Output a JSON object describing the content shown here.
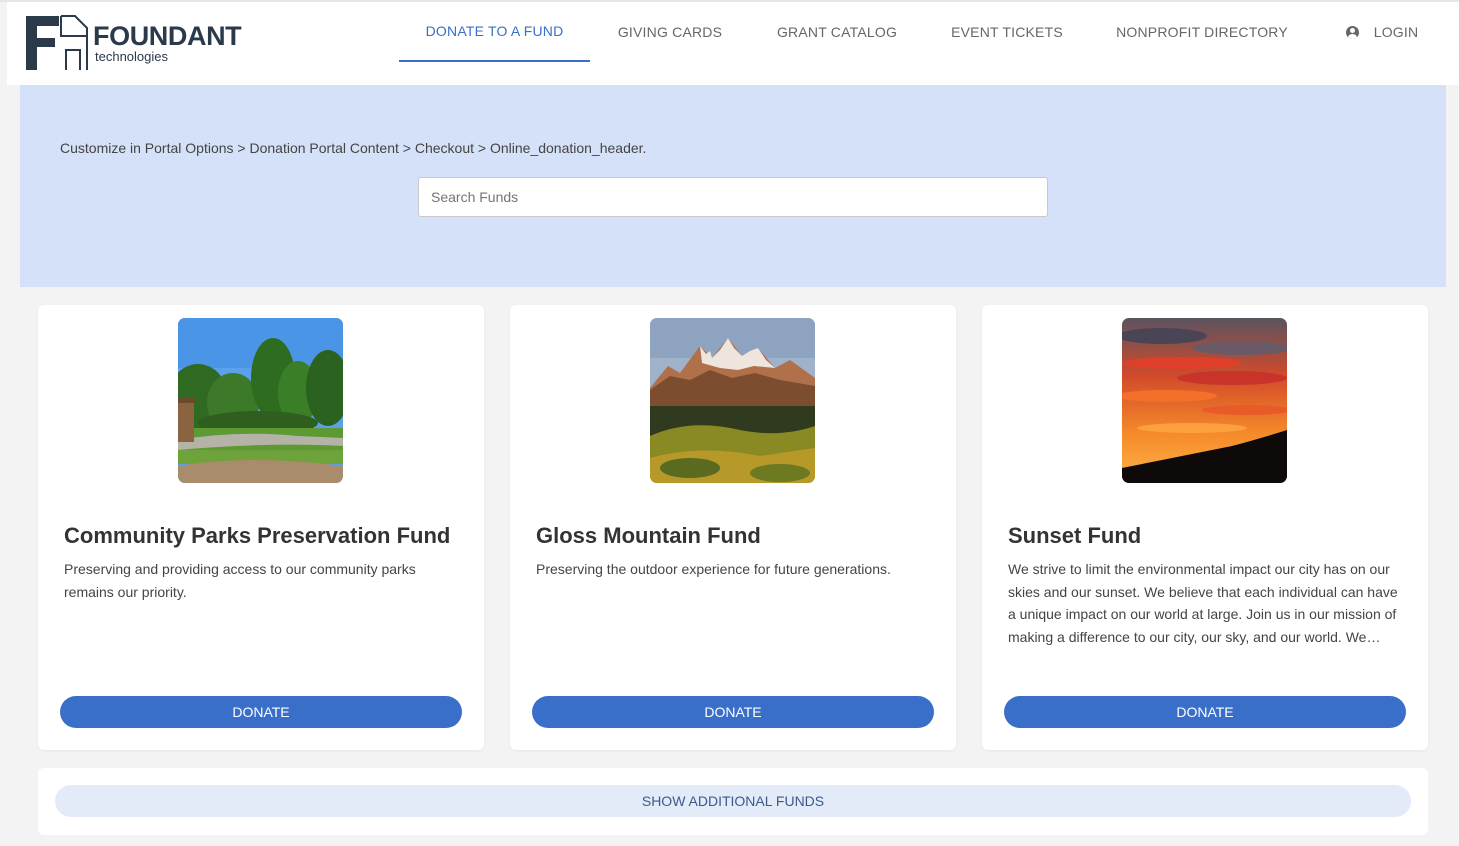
{
  "brand": {
    "name": "FOUNDANT",
    "tagline": "technologies"
  },
  "nav": {
    "items": [
      {
        "label": "DONATE TO A FUND",
        "active": true
      },
      {
        "label": "GIVING CARDS",
        "active": false
      },
      {
        "label": "GRANT CATALOG",
        "active": false
      },
      {
        "label": "EVENT TICKETS",
        "active": false
      },
      {
        "label": "NONPROFIT DIRECTORY",
        "active": false
      }
    ],
    "login": {
      "label": "LOGIN",
      "icon": "user-circle-icon"
    }
  },
  "hero": {
    "breadcrumb": "Customize in Portal Options > Donation Portal Content > Checkout > Online_donation_header.",
    "search": {
      "placeholder": "Search Funds",
      "value": ""
    }
  },
  "funds": [
    {
      "title": "Community Parks Preservation Fund",
      "description": "Preserving and providing access to our community parks remains our priority.",
      "image": "park-photo",
      "button": "DONATE"
    },
    {
      "title": "Gloss Mountain Fund",
      "description": "Preserving the outdoor experience for future generations.",
      "image": "mountain-photo",
      "button": "DONATE"
    },
    {
      "title": "Sunset Fund",
      "description": "We strive to limit the environmental impact our city has on our skies and our sunset. We believe that each individual can have a unique impact on our world at large. Join us in our mission of making a difference to our city, our sky, and our world. We…",
      "image": "sunset-photo",
      "button": "DONATE"
    }
  ],
  "show_more": {
    "label": "SHOW ADDITIONAL FUNDS"
  },
  "colors": {
    "accent": "#3a6fc9",
    "hero_bg": "#d5e1f8",
    "page_bg": "#f3f3f3",
    "brand_dark": "#2b3a4a"
  }
}
